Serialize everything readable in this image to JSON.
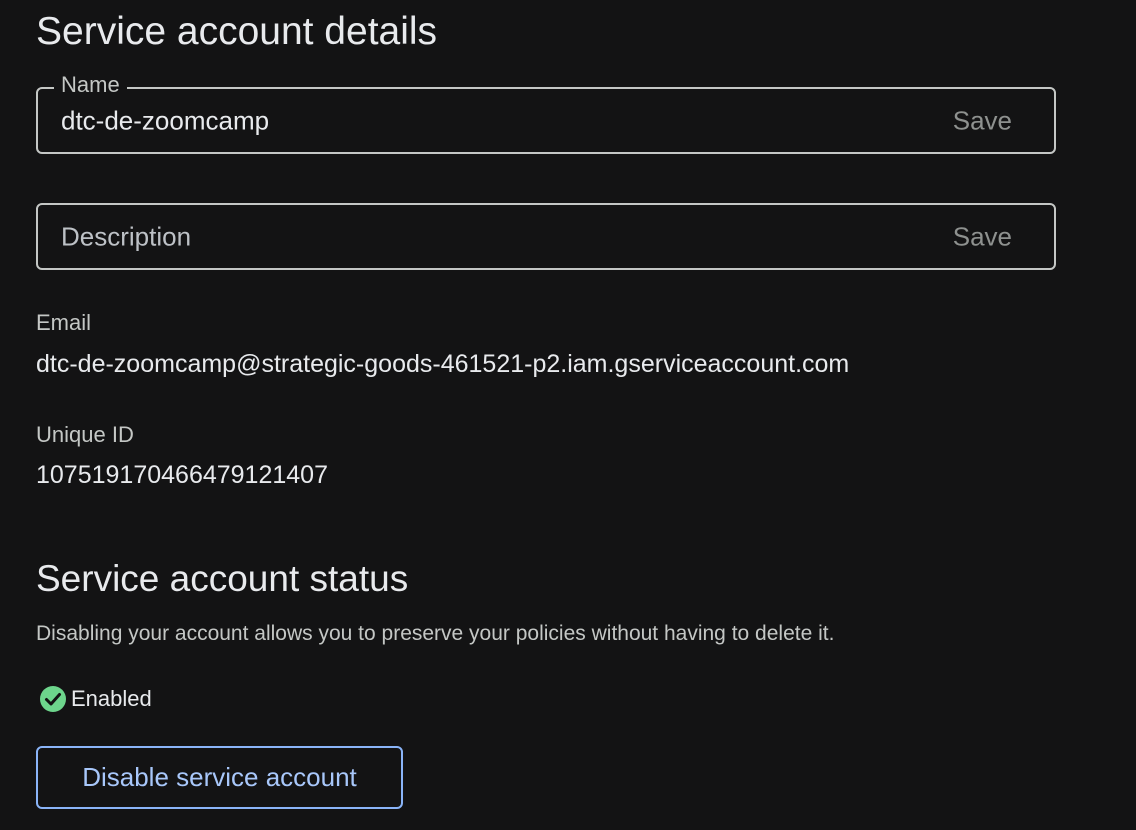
{
  "details": {
    "title": "Service account details",
    "name_field": {
      "label": "Name",
      "value": "dtc-de-zoomcamp",
      "save_label": "Save"
    },
    "description_field": {
      "placeholder": "Description",
      "value": "",
      "save_label": "Save"
    },
    "email": {
      "label": "Email",
      "value": "dtc-de-zoomcamp@strategic-goods-461521-p2.iam.gserviceaccount.com"
    },
    "unique_id": {
      "label": "Unique ID",
      "value": "107519170466479121407"
    }
  },
  "status": {
    "title": "Service account status",
    "helper": "Disabling your account allows you to preserve your policies without having to delete it.",
    "state_icon": "check-circle-icon",
    "state_label": "Enabled",
    "disable_button_label": "Disable service account"
  },
  "colors": {
    "background": "#131314",
    "success": "#6dd58c",
    "accent": "#a8c7fa"
  }
}
